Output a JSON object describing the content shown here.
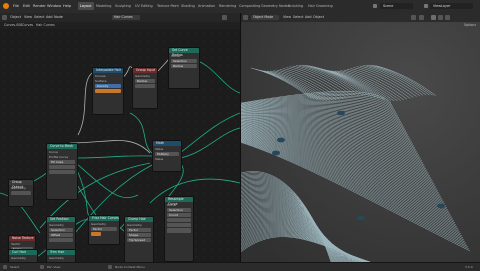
{
  "menu": [
    "File",
    "Edit",
    "Render",
    "Window",
    "Help"
  ],
  "workspace_tabs": [
    "Layout",
    "Modeling",
    "Sculpting",
    "UV Editing",
    "Texture Paint",
    "Shading",
    "Animation",
    "Rendering",
    "Compositing",
    "Geometry Nodes",
    "Scripting",
    "Hair Grooming"
  ],
  "active_tab_index": 0,
  "scene": "Scene",
  "view_layer": "ViewLayer",
  "node_editor": {
    "header": [
      "Object",
      "View",
      "Select",
      "Add",
      "Node"
    ],
    "modifier": "Hair Curves",
    "breadcrumb": [
      "Curves.008",
      "Curves",
      "Hair Curves"
    ],
    "nodes": [
      {
        "title": "Set Curve Radius",
        "rows": [
          "Curve",
          "Selection",
          "Radius"
        ],
        "head": "teal"
      },
      {
        "title": "Interpolate Hair",
        "rows": [
          "Curves",
          "Surface",
          "Density"
        ],
        "head": "blue"
      },
      {
        "title": "Group Input",
        "rows": [
          "Geometry",
          "Radius"
        ],
        "head": "red"
      },
      {
        "title": "Math",
        "rows": [
          "Value",
          "Multiply",
          "Value"
        ],
        "head": "blue"
      },
      {
        "title": "Curve to Mesh",
        "rows": [
          "Curve",
          "Profile Curve",
          "Fill Caps"
        ],
        "head": "teal"
      },
      {
        "title": "Group Output",
        "rows": [
          "Geometry"
        ],
        "head": "gray"
      },
      {
        "title": "Resample Curve",
        "rows": [
          "Curve",
          "Selection",
          "Count"
        ],
        "head": "teal"
      },
      {
        "title": "Frizz Hair Curves",
        "rows": [
          "Geometry",
          "Factor",
          "Distance",
          "Shape"
        ],
        "head": "teal"
      },
      {
        "title": "Clump Hair",
        "rows": [
          "Geometry",
          "Factor",
          "Shape",
          "Tip Spread",
          "Seed"
        ],
        "head": "teal"
      },
      {
        "title": "Noise Texture",
        "rows": [
          "Vector",
          "Scale",
          "Detail"
        ],
        "head": "red"
      },
      {
        "title": "Set Position",
        "rows": [
          "Geometry",
          "Selection",
          "Offset"
        ],
        "head": "teal"
      },
      {
        "title": "Curl Hair",
        "rows": [
          "Geometry",
          "Factor",
          "Radius",
          "Frequency"
        ],
        "head": "teal"
      },
      {
        "title": "Trim Hair",
        "rows": [
          "Geometry",
          "Length"
        ],
        "head": "teal"
      }
    ]
  },
  "viewport": {
    "mode": "Object Mode",
    "header": [
      "View",
      "Select",
      "Add",
      "Object"
    ],
    "options_label": "Options"
  },
  "status": {
    "left": "Select",
    "middle": "Pan View",
    "right": "Node Context Menu",
    "version": "3.5.0"
  }
}
